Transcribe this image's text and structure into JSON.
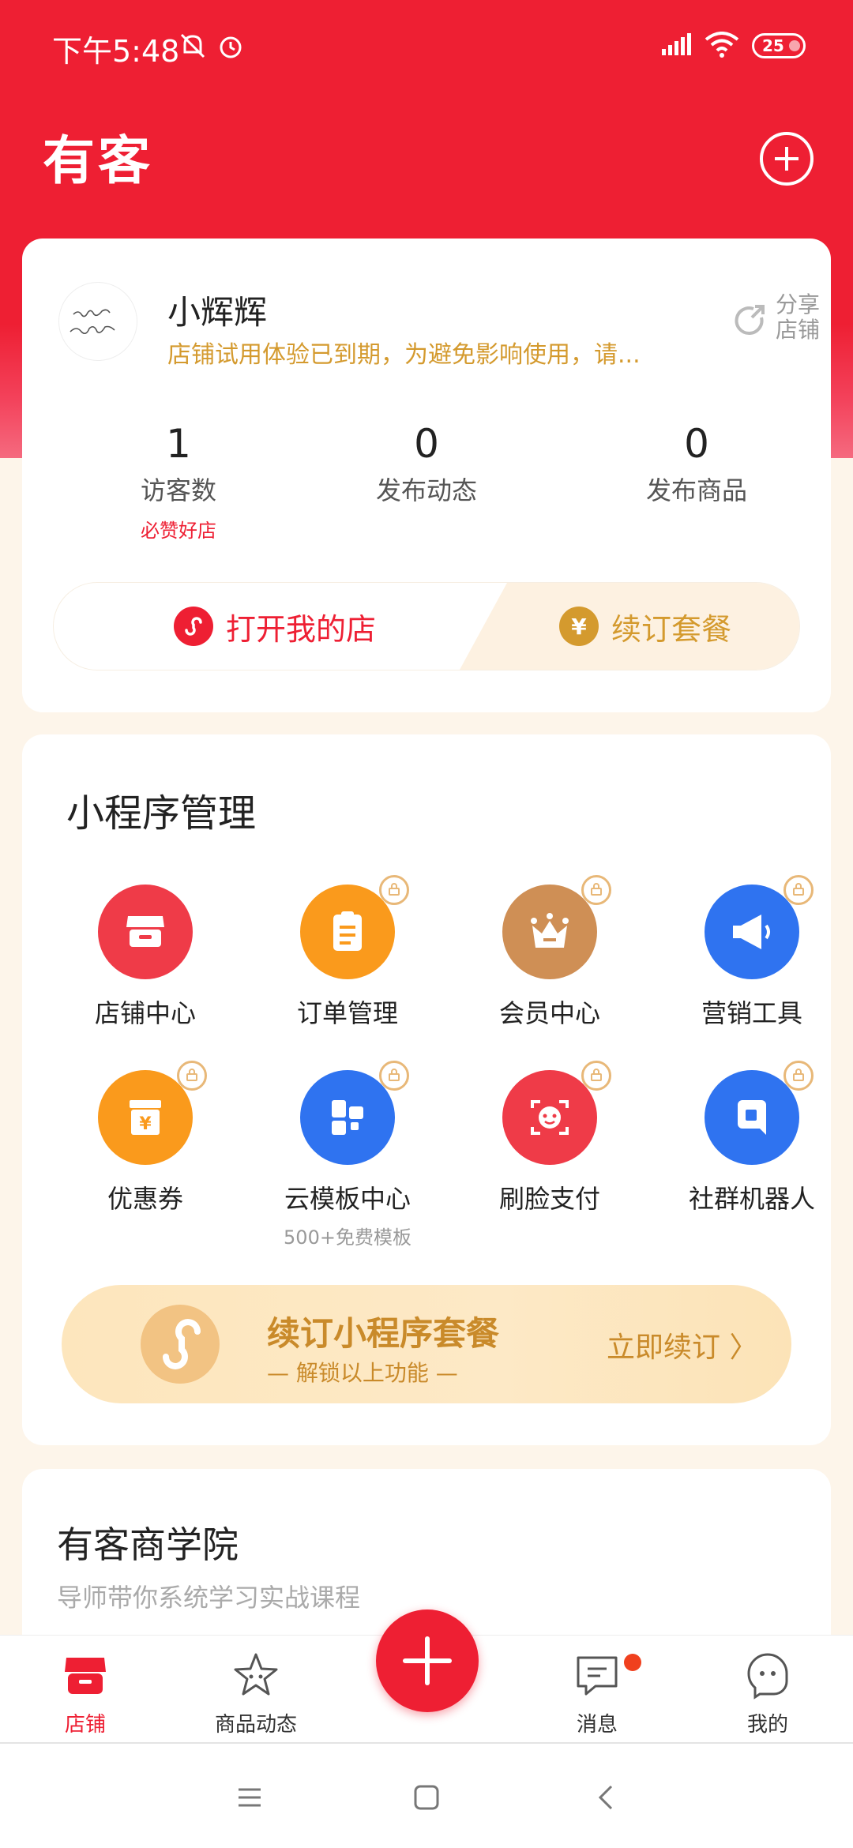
{
  "status_bar": {
    "time": "下午5:48",
    "battery": "25"
  },
  "header": {
    "app_title": "有客"
  },
  "store": {
    "name": "小辉辉",
    "notice": "店铺试用体验已到期，为避免影响使用，请...",
    "share_label": "分享店铺",
    "stats": [
      {
        "value": "1",
        "label": "访客数",
        "sub": "必赞好店"
      },
      {
        "value": "0",
        "label": "发布动态"
      },
      {
        "value": "0",
        "label": "发布商品"
      }
    ],
    "open_store_label": "打开我的店",
    "renew_label": "续订套餐"
  },
  "miniapp": {
    "title": "小程序管理",
    "tiles": [
      {
        "label": "店铺中心",
        "icon": "store-icon",
        "color": "#EF3B48",
        "locked": false
      },
      {
        "label": "订单管理",
        "icon": "clipboard-icon",
        "color": "#FA9A1C",
        "locked": true
      },
      {
        "label": "会员中心",
        "icon": "crown-icon",
        "color": "#CF8F55",
        "locked": true
      },
      {
        "label": "营销工具",
        "icon": "megaphone-icon",
        "color": "#2F73F0",
        "locked": true
      },
      {
        "label": "优惠券",
        "icon": "coupon-icon",
        "color": "#FA9A1C",
        "locked": true
      },
      {
        "label": "云模板中心",
        "icon": "template-icon",
        "color": "#2F73F0",
        "locked": true,
        "sub": "500+免费模板"
      },
      {
        "label": "刷脸支付",
        "icon": "face-scan-icon",
        "color": "#EF3B48",
        "locked": true
      },
      {
        "label": "社群机器人",
        "icon": "robot-icon",
        "color": "#2F73F0",
        "locked": true
      }
    ],
    "banner": {
      "title": "续订小程序套餐",
      "subtitle": "—  解锁以上功能  —",
      "cta": "立即续订 〉"
    }
  },
  "academy": {
    "title": "有客商学院",
    "subtitle": "导师带你系统学习实战课程"
  },
  "bottom_nav": [
    {
      "label": "店铺",
      "active": true
    },
    {
      "label": "商品动态",
      "active": false
    },
    {
      "label": "消息",
      "active": false
    },
    {
      "label": "我的",
      "active": false
    }
  ],
  "colors": {
    "brand_red": "#EE1F33",
    "gold": "#D49A2E",
    "page_bg": "#FDF5EA"
  }
}
